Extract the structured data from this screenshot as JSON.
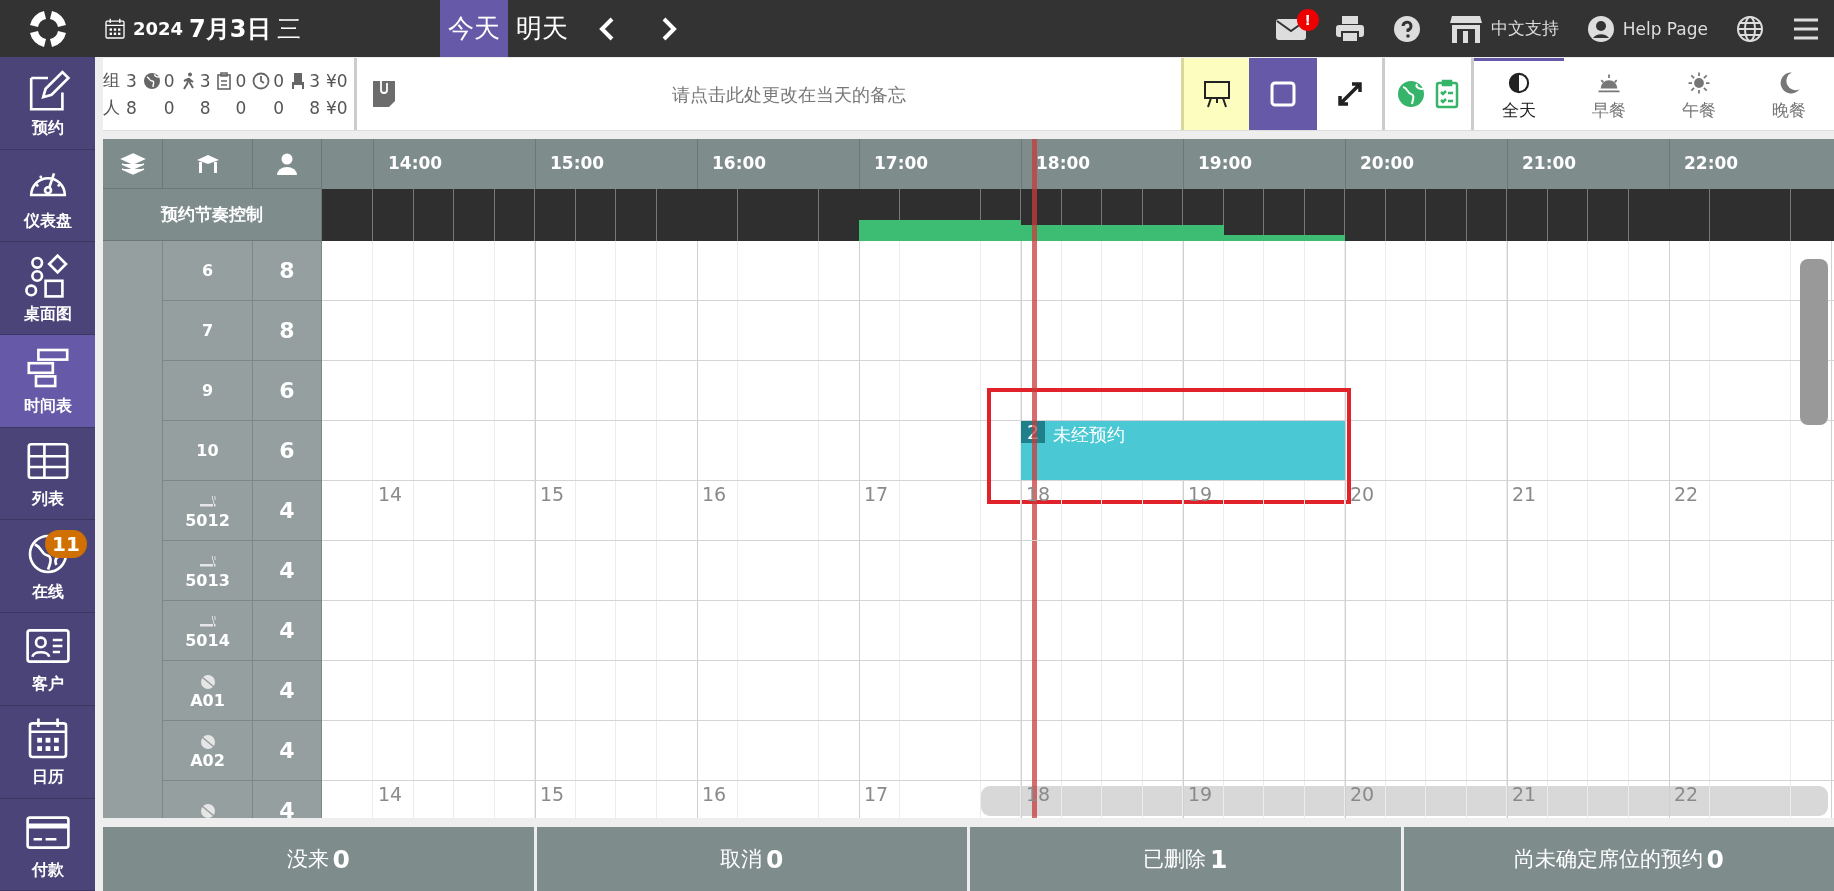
{
  "top_bar": {
    "date": {
      "year": "2024",
      "day": "7月3日",
      "weekday": "三"
    },
    "day_buttons": [
      {
        "label": "今天",
        "selected": true
      },
      {
        "label": "明天",
        "selected": false
      }
    ],
    "mail_badge": "!",
    "support_label": "中文支持",
    "help_label": "Help Page"
  },
  "sidebar": {
    "items": [
      {
        "label": "预约",
        "selected": false
      },
      {
        "label": "仪表盘",
        "selected": false
      },
      {
        "label": "桌面图",
        "selected": false
      },
      {
        "label": "时间表",
        "selected": true
      },
      {
        "label": "列表",
        "selected": false
      },
      {
        "label": "在线",
        "selected": false,
        "badge": "11"
      },
      {
        "label": "客户",
        "selected": false
      },
      {
        "label": "日历",
        "selected": false
      },
      {
        "label": "付款",
        "selected": false
      }
    ]
  },
  "summary": {
    "rows": [
      {
        "label": "组",
        "values": [
          "3",
          "0",
          "3",
          "0",
          "0",
          "3"
        ],
        "money": "¥0"
      },
      {
        "label": "人",
        "values": [
          "8",
          "0",
          "8",
          "0",
          "0",
          "8"
        ],
        "money": "¥0"
      }
    ]
  },
  "memo": {
    "placeholder": "请点击此处更改在当天的备忘"
  },
  "meal_tabs": [
    {
      "label": "全天",
      "selected": true
    },
    {
      "label": "早餐",
      "selected": false
    },
    {
      "label": "午餐",
      "selected": false
    },
    {
      "label": "晚餐",
      "selected": false
    }
  ],
  "timeline": {
    "hours": [
      "14:00",
      "15:00",
      "16:00",
      "17:00",
      "18:00",
      "19:00",
      "20:00",
      "21:00",
      "22:00"
    ],
    "rhythm_label": "预约节奏控制"
  },
  "tables": [
    {
      "kind": "plain",
      "name": "6",
      "seats": "8"
    },
    {
      "kind": "plain",
      "name": "7",
      "seats": "8"
    },
    {
      "kind": "plain",
      "name": "9",
      "seats": "6"
    },
    {
      "kind": "plain",
      "name": "10",
      "seats": "6",
      "reservation": {
        "party": "2",
        "label": "未经预约",
        "highlighted": true
      }
    },
    {
      "kind": "smoking",
      "name": "5012",
      "seats": "4",
      "hour_marks": [
        "14",
        "15",
        "16",
        "17",
        "18",
        "19",
        "20",
        "21",
        "22"
      ]
    },
    {
      "kind": "smoking",
      "name": "5013",
      "seats": "4"
    },
    {
      "kind": "smoking",
      "name": "5014",
      "seats": "4"
    },
    {
      "kind": "no-smoking",
      "name": "A01",
      "seats": "4"
    },
    {
      "kind": "no-smoking",
      "name": "A02",
      "seats": "4"
    },
    {
      "kind": "no-smoking",
      "seats": "4",
      "hour_marks": [
        "14",
        "15",
        "16",
        "17",
        "18",
        "19",
        "20",
        "21",
        "22"
      ]
    }
  ],
  "footer": [
    {
      "label": "没来",
      "count": "0"
    },
    {
      "label": "取消",
      "count": "0"
    },
    {
      "label": "已删除",
      "count": "1"
    },
    {
      "label": "尚未确定席位的预约",
      "count": "0"
    }
  ]
}
